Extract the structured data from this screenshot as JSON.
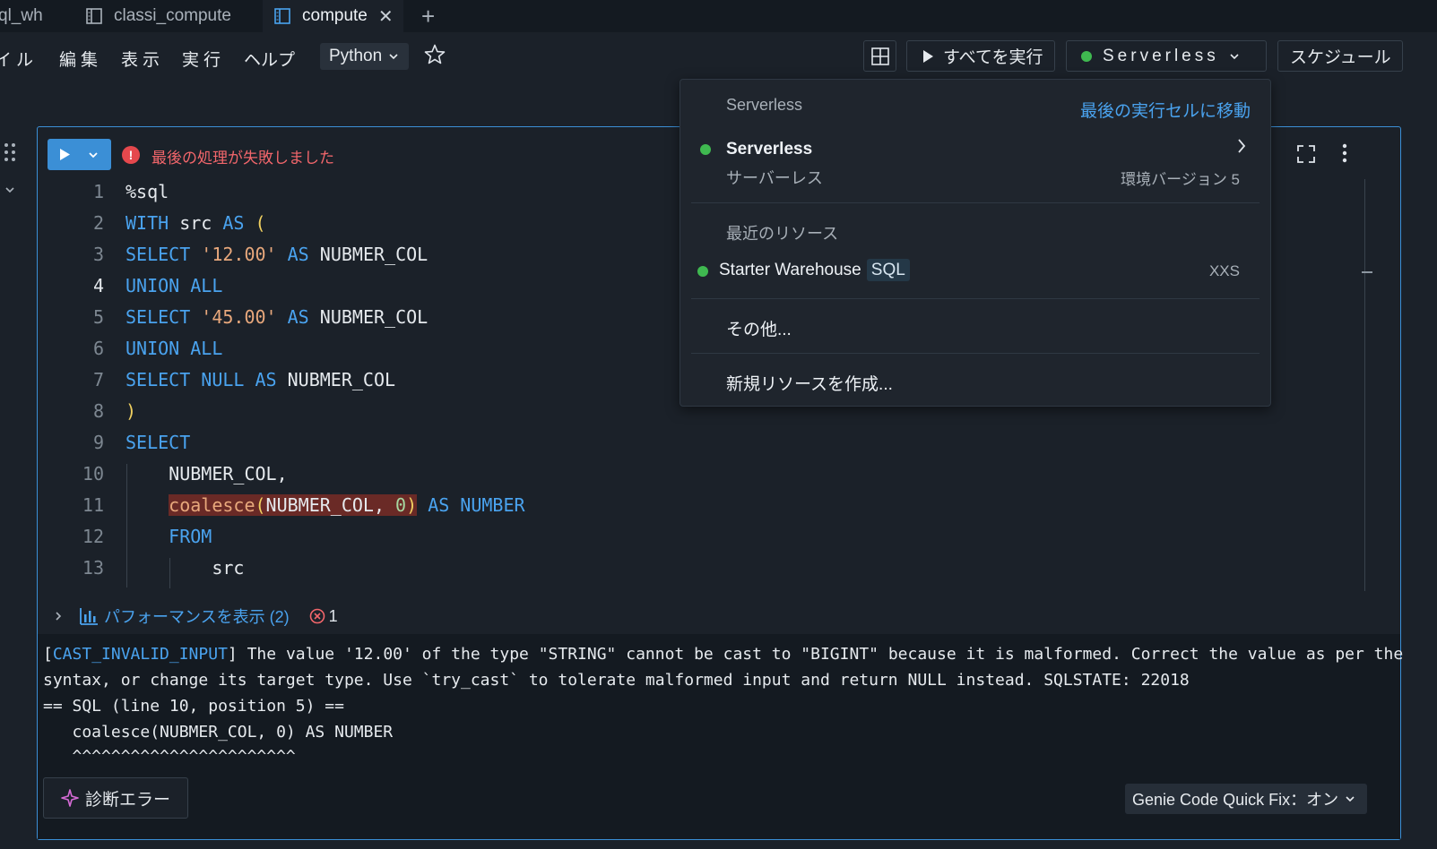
{
  "tabs": [
    {
      "label": "ql_wh",
      "active": false
    },
    {
      "label": "classi_compute",
      "active": false
    },
    {
      "label": "compute",
      "active": true
    }
  ],
  "menu": {
    "items": [
      "イル",
      "編集",
      "表示",
      "実行",
      "ヘルプ"
    ],
    "language": "Python"
  },
  "toolbar": {
    "run_all": "すべてを実行",
    "compute": "Serverless",
    "schedule": "スケジュール"
  },
  "cell": {
    "error_status": "最後の処理が失敗しました",
    "code_lines": [
      "%sql",
      "WITH src AS (",
      "SELECT '12.00' AS NUBMER_COL",
      "UNION ALL",
      "SELECT '45.00' AS NUBMER_COL",
      "UNION ALL",
      "SELECT NULL AS NUBMER_COL",
      ")",
      "SELECT",
      "    NUBMER_COL,",
      "    coalesce(NUBMER_COL, 0) AS NUMBER",
      "    FROM",
      "        src"
    ],
    "line_numbers": [
      "1",
      "2",
      "3",
      "4",
      "5",
      "6",
      "7",
      "8",
      "9",
      "10",
      "11",
      "12",
      "13"
    ],
    "current_line": 4,
    "performance_label": "パフォーマンスを表示 (2)",
    "error_count": "1"
  },
  "output": {
    "error_code": "CAST_INVALID_INPUT",
    "lines": [
      "] The value '12.00' of the type \"STRING\" cannot be cast to \"BIGINT\" because it is malformed. Correct the value as per the",
      "syntax, or change its target type. Use `try_cast` to tolerate malformed input and return NULL instead. SQLSTATE: 22018",
      "== SQL (line 10, position 5) ==",
      "   coalesce(NUBMER_COL, 0) AS NUMBER",
      "   ^^^^^^^^^^^^^^^^^^^^^^^"
    ]
  },
  "diagnose_button": "診断エラー",
  "genie_quick_fix": "Genie Code Quick Fix：オン",
  "popup": {
    "header": "Serverless",
    "go_to_last": "最後の実行セルに移動",
    "serverless_name": "Serverless",
    "serverless_sub": "サーバーレス",
    "env_version": "環境バージョン 5",
    "recent_header": "最近のリソース",
    "warehouse_name": "Starter Warehouse",
    "warehouse_badge": "SQL",
    "warehouse_size": "XXS",
    "other": "その他...",
    "create_new": "新規リソースを作成..."
  },
  "colors": {
    "accent": "#3b8fd6",
    "error": "#e5484d",
    "status_green": "#3fb950",
    "background": "#1b2129"
  }
}
